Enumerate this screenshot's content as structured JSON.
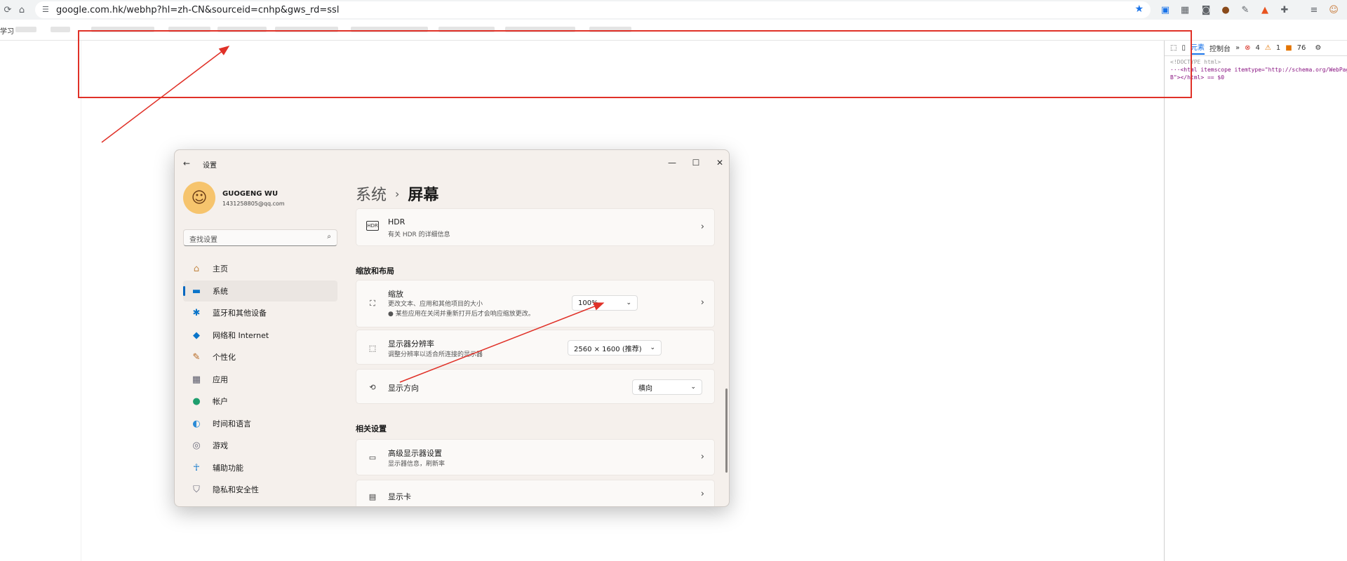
{
  "browser": {
    "url": "google.com.hk/webhp?hl=zh-CN&sourceid=cnhp&gws_rd=ssl",
    "bookmark_first": "学习"
  },
  "devtools": {
    "tab_elements": "元素",
    "tab_console": "控制台",
    "more_tabs": "»",
    "errors": "4",
    "warnings": "1",
    "info": "76",
    "code_line_1": "<!DOCTYPE html>",
    "code_line_2": "···<html itemscope itemtype=\"http://schema.org/WebPage\" lang=\"",
    "code_line_3": "B\"></html> == $0"
  },
  "settings": {
    "title": "设置",
    "user": {
      "name": "GUOGENG WU",
      "email": "1431258805@qq.com"
    },
    "search_placeholder": "查找设置",
    "nav": [
      {
        "label": "主页",
        "icon": "home-icon"
      },
      {
        "label": "系统",
        "icon": "system-icon"
      },
      {
        "label": "蓝牙和其他设备",
        "icon": "bluetooth-icon"
      },
      {
        "label": "网络和 Internet",
        "icon": "wifi-icon"
      },
      {
        "label": "个性化",
        "icon": "brush-icon"
      },
      {
        "label": "应用",
        "icon": "apps-icon"
      },
      {
        "label": "帐户",
        "icon": "account-icon"
      },
      {
        "label": "时间和语言",
        "icon": "globe-icon"
      },
      {
        "label": "游戏",
        "icon": "gamepad-icon"
      },
      {
        "label": "辅助功能",
        "icon": "accessibility-icon"
      },
      {
        "label": "隐私和安全性",
        "icon": "shield-icon"
      }
    ],
    "breadcrumb": {
      "parent": "系统",
      "separator": "›",
      "current": "屏幕"
    },
    "hdr": {
      "title": "HDR",
      "subtitle": "有关 HDR 的详细信息",
      "icon_text": "HDR"
    },
    "section_scale": "缩放和布局",
    "scale": {
      "title": "缩放",
      "subtitle": "更改文本、应用和其他项目的大小",
      "note": "某些应用在关闭并重新打开后才会响应缩放更改。",
      "value": "100%"
    },
    "resolution": {
      "title": "显示器分辨率",
      "subtitle": "调整分辨率以适合所连接的显示器",
      "value": "2560 × 1600 (推荐)"
    },
    "orientation": {
      "title": "显示方向",
      "value": "横向"
    },
    "section_related": "相关设置",
    "advanced": {
      "title": "高级显示器设置",
      "subtitle": "显示器信息，刷新率"
    },
    "gpu": {
      "title": "显示卡"
    }
  },
  "colors": {
    "annotation_red": "#e03128",
    "accent_blue": "#0067c0"
  }
}
